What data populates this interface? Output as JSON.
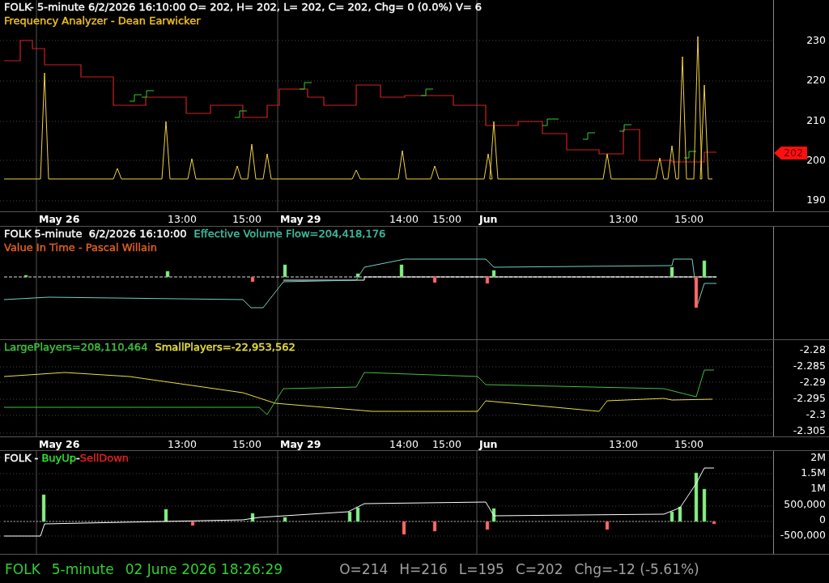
{
  "panes": [
    {
      "kind": "price",
      "legend": [
        [
          {
            "text": "FOLK- 5-minute 6/2/2026 16:10:00 O= 202, H= 202, L= 202, C= 202, Chg= 0 (0.0%) V= 6",
            "color": "#ffffff"
          }
        ],
        [
          {
            "text": "Frequency Analyzer - Dean Earwicker",
            "color": "#f0c020"
          }
        ]
      ],
      "y_axis": [
        "230",
        "220",
        "210",
        "200",
        "190"
      ],
      "price_marker": "202",
      "time_axis": [
        {
          "text": "May 26",
          "kind": "day"
        },
        {
          "text": "13:00",
          "kind": "time"
        },
        {
          "text": "15:00",
          "kind": "time"
        },
        {
          "text": "May 29",
          "kind": "day"
        },
        {
          "text": "14:00",
          "kind": "time"
        },
        {
          "text": "15:00",
          "kind": "time"
        },
        {
          "text": "Jun",
          "kind": "day"
        },
        {
          "text": "13:00",
          "kind": "time"
        },
        {
          "text": "15:00",
          "kind": "time"
        }
      ]
    },
    {
      "kind": "flow",
      "legend": [
        [
          {
            "text": "FOLK 5-minute  6/2/2026 16:10:00",
            "color": "#ffffff"
          },
          {
            "text": "Effective Volume Flow=204,418,176",
            "color": "#40c0a0"
          }
        ],
        [
          {
            "text": "Value In Time - Pascal Willain",
            "color": "#e06020"
          }
        ]
      ]
    },
    {
      "kind": "players",
      "legend": [
        [
          {
            "text": "LargePlayers=208,110,464",
            "color": "#40c040"
          },
          {
            "text": "SmallPlayers=-22,953,562",
            "color": "#e8e040"
          }
        ]
      ],
      "y_axis": [
        "-2.28",
        "-2.285",
        "-2.29",
        "-2.295",
        "-2.3",
        "-2.305"
      ],
      "time_axis": [
        {
          "text": "May 26",
          "kind": "day"
        },
        {
          "text": "13:00",
          "kind": "time"
        },
        {
          "text": "15:00",
          "kind": "time"
        },
        {
          "text": "May 29",
          "kind": "day"
        },
        {
          "text": "14:00",
          "kind": "time"
        },
        {
          "text": "15:00",
          "kind": "time"
        },
        {
          "text": "Jun",
          "kind": "day"
        },
        {
          "text": "13:00",
          "kind": "time"
        },
        {
          "text": "15:00",
          "kind": "time"
        }
      ]
    },
    {
      "kind": "buyup",
      "legend": [
        [
          {
            "text": "FOLK - ",
            "color": "#ffffff"
          },
          {
            "text": "BuyUp",
            "color": "#30e030"
          },
          {
            "text": "-",
            "color": "#ffffff"
          },
          {
            "text": "SellDown",
            "color": "#e02020"
          }
        ]
      ],
      "y_axis": [
        "2M",
        "1.5M",
        "1M",
        "500,000",
        "0",
        "-500,000"
      ]
    }
  ],
  "status_bar": {
    "left": [
      "FOLK",
      "5-minute",
      "02 June 2026 18:26:29"
    ],
    "right": [
      "O=214",
      "H=216",
      "L=195",
      "C=202",
      "Chg=-12 (-5.61%)"
    ]
  }
}
